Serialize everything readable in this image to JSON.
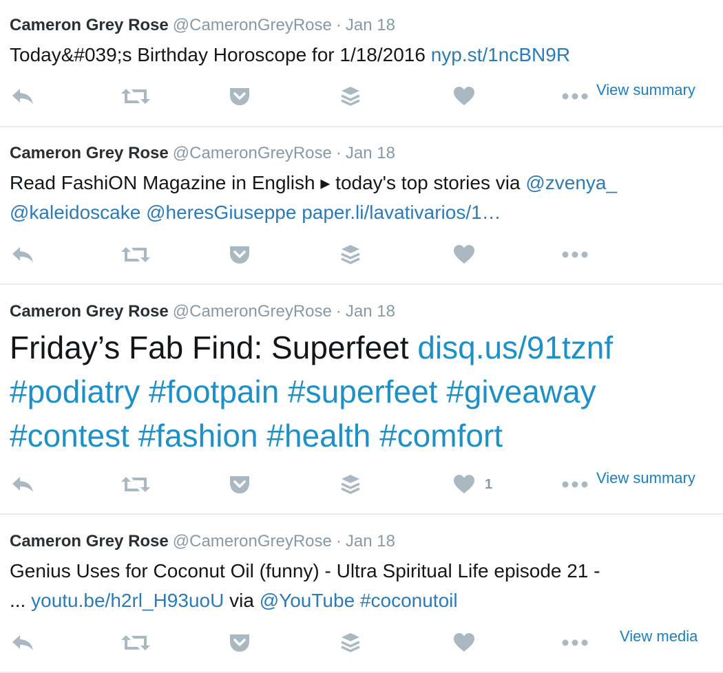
{
  "icons": [
    "reply-icon",
    "retweet-icon",
    "pocket-icon",
    "buffer-icon",
    "like-icon",
    "more-icon"
  ],
  "colors": {
    "link": "#2b7bb9",
    "meta": "#8899a6",
    "icon": "#aab8c2",
    "divider": "#e6ecf0"
  },
  "tweets": [
    {
      "name": "Cameron Grey Rose",
      "handle": "@CameronGreyRose",
      "sep": "·",
      "date": "Jan 18",
      "line1_text": "Today&#039;s Birthday Horoscope for 1/18/2016 ",
      "line1_link": "nyp.st/1ncBN9R",
      "action_label": "View summary"
    },
    {
      "name": "Cameron Grey Rose",
      "handle": "@CameronGreyRose",
      "sep": "·",
      "date": "Jan 18",
      "line1_text": "Read FashiON Magazine in English ▸ today's top stories via ",
      "line1_link": "@zvenya_",
      "line2_links": [
        "@kaleidoscake",
        "@heresGiuseppe",
        "paper.li/lavativarios/1…"
      ]
    },
    {
      "name": "Cameron Grey Rose",
      "handle": "@CameronGreyRose",
      "sep": "·",
      "date": "Jan 18",
      "line1_text": "Friday’s Fab Find: Superfeet ",
      "line1_link": "disq.us/91tznf",
      "line2_links": [
        "#podiatry",
        "#footpain",
        "#superfeet",
        "#giveaway"
      ],
      "line3_links": [
        "#contest",
        "#fashion",
        "#health",
        "#comfort"
      ],
      "like_count": "1",
      "action_label": "View summary"
    },
    {
      "name": "Cameron Grey Rose",
      "handle": "@CameronGreyRose",
      "sep": "·",
      "date": "Jan 18",
      "line1_text": "Genius Uses for Coconut Oil (funny) - Ultra Spiritual Life episode 21 -",
      "line2_prefix": "... ",
      "line2_link1": "youtu.be/h2rl_H93uoU",
      "line2_mid": " via ",
      "line2_link2": "@YouTube",
      "line2_link3": "#coconutoil",
      "action_label": "View media"
    }
  ]
}
